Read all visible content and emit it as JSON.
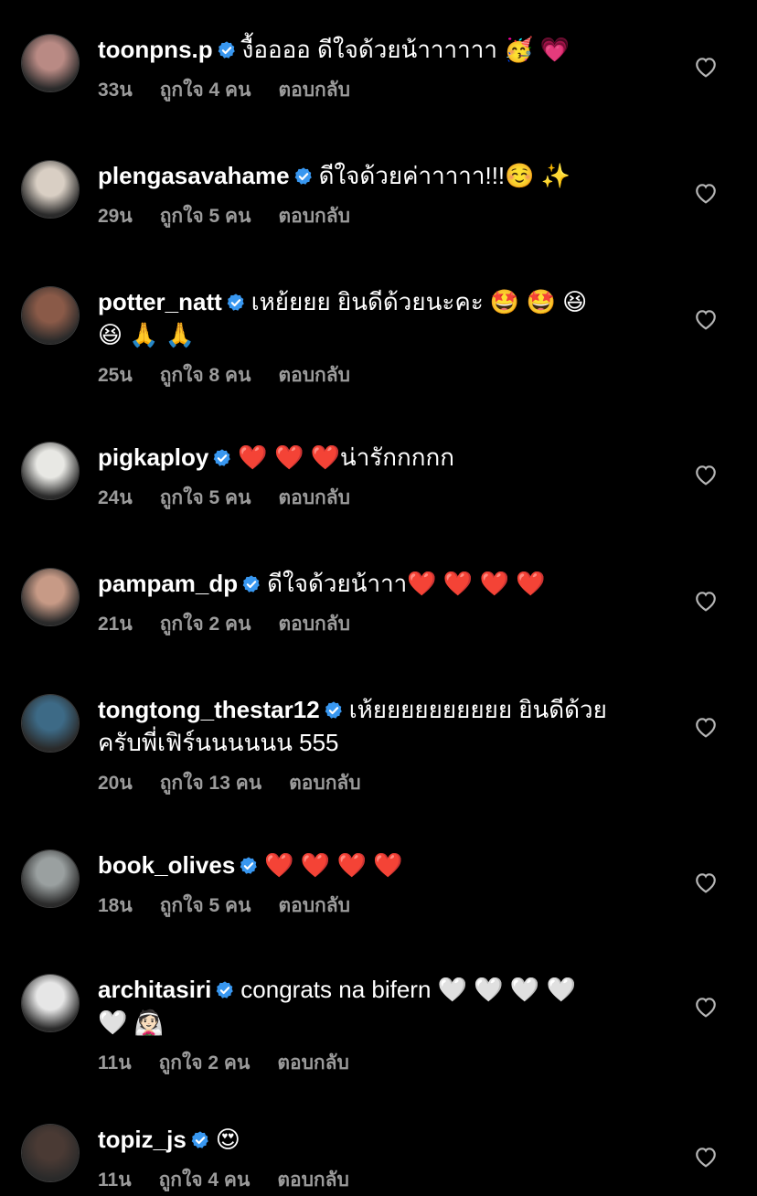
{
  "comments": [
    {
      "user": "toonpns.p",
      "text": "งื้ออออ ดีใจด้วยน้าาาาาา 🥳 💗",
      "time": "33น",
      "likes": "ถูกใจ 4 คน",
      "reply": "ตอบกลับ",
      "avatar_color": "#b98a84"
    },
    {
      "user": "plengasavahame",
      "text": "ดีใจด้วยค่าาาาา!!!☺️ ✨",
      "time": "29น",
      "likes": "ถูกใจ 5 คน",
      "reply": "ตอบกลับ",
      "avatar_color": "#d9cfc4"
    },
    {
      "user": "potter_natt",
      "text": "เหย้ยยย ยินดีด้วยนะคะ 🤩 🤩 😆",
      "text2": "😆 🙏 🙏",
      "time": "25น",
      "likes": "ถูกใจ 8 คน",
      "reply": "ตอบกลับ",
      "avatar_color": "#8a5a48"
    },
    {
      "user": "pigkaploy",
      "text": "❤️ ❤️ ❤️น่ารักกกกก",
      "time": "24น",
      "likes": "ถูกใจ 5 คน",
      "reply": "ตอบกลับ",
      "avatar_color": "#e8e8e4"
    },
    {
      "user": "pampam_dp",
      "text": "ดีใจด้วยน้าาา❤️ ❤️ ❤️ ❤️",
      "time": "21น",
      "likes": "ถูกใจ 2 คน",
      "reply": "ตอบกลับ",
      "avatar_color": "#c79a86"
    },
    {
      "user": "tongtong_thestar12",
      "text": "เห้ยยยยยยยยยย ยินดีด้วย",
      "text2": "ครับพี่เฟิร์นนนนนน 555",
      "time": "20น",
      "likes": "ถูกใจ 13 คน",
      "reply": "ตอบกลับ",
      "avatar_color": "#3d6a86"
    },
    {
      "user": "book_olives",
      "text": "❤️ ❤️ ❤️ ❤️",
      "time": "18น",
      "likes": "ถูกใจ 5 คน",
      "reply": "ตอบกลับ",
      "avatar_color": "#9aa0a0"
    },
    {
      "user": "architasiri",
      "text": "congrats na bifern 🤍 🤍 🤍 🤍",
      "text2": "🤍 👰🏻",
      "time": "11น",
      "likes": "ถูกใจ 2 คน",
      "reply": "ตอบกลับ",
      "avatar_color": "#e6e6e6"
    },
    {
      "user": "topiz_js",
      "text": "😍",
      "time": "11น",
      "likes": "ถูกใจ 4 คน",
      "reply": "ตอบกลับ",
      "avatar_color": "#4a3a34"
    }
  ],
  "colors": {
    "background": "#000000",
    "meta": "#9b9b9b",
    "verified": "#3897f0"
  },
  "icons": {
    "verified": "verified-badge-icon",
    "like": "heart-outline-icon"
  }
}
